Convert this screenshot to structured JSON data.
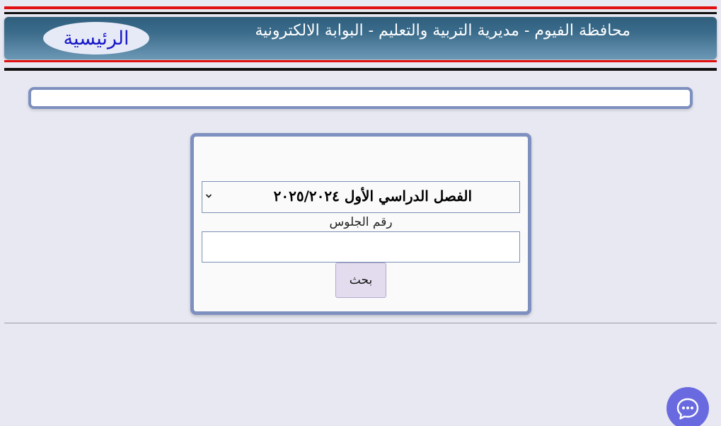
{
  "header": {
    "title": "محافظة الفيوم - مديرية التربية والتعليم - البوابة الالكترونية",
    "home_label": "الرئيسية"
  },
  "form": {
    "term_select": {
      "selected": "الفصل الدراسي الأول ٢٠٢٥/٢٠٢٤"
    },
    "seat_number_label": "رقم الجلوس",
    "seat_number_value": "",
    "search_button": "بحث"
  },
  "icons": {
    "dropdown": "chevron-down-icon",
    "chat": "chat-bubble-icon"
  },
  "colors": {
    "header_dark": "#2f5f7d",
    "header_light": "#6b98b5",
    "stripe_red": "#e01010",
    "stripe_black": "#111111",
    "panel_border": "#7e90bf",
    "home_text": "#1818c8",
    "chat_button": "#6a6ae0"
  }
}
